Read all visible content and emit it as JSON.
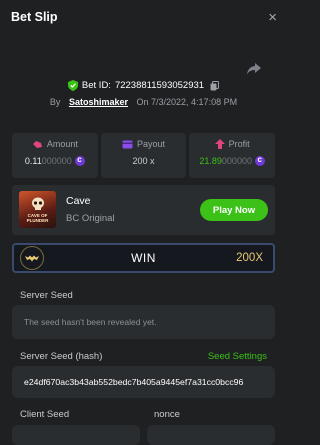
{
  "header": {
    "title": "Bet Slip",
    "close": "×"
  },
  "bet": {
    "id_label": "Bet ID:",
    "id": "72238811593052931",
    "by_label": "By",
    "user": "Satoshimaker",
    "on_label": "On",
    "datetime": "7/3/2022, 4:17:08 PM"
  },
  "stats": {
    "amount": {
      "label": "Amount",
      "value_main": "0.11",
      "value_dim": "000000"
    },
    "payout": {
      "label": "Payout",
      "value": "200 x"
    },
    "profit": {
      "label": "Profit",
      "value_main": "21.89",
      "value_dim": "000000"
    }
  },
  "game": {
    "name": "Cave",
    "provider": "BC Original",
    "play_label": "Play Now",
    "thumb_text": "CAVE OF PLUNDER"
  },
  "result": {
    "label": "WIN",
    "multiplier": "200X"
  },
  "seeds": {
    "server_seed_label": "Server Seed",
    "server_seed_placeholder": "The seed hasn't been revealed yet.",
    "server_hash_label": "Server Seed (hash)",
    "seed_settings_label": "Seed Settings",
    "server_hash": "e24df670ac3b43ab552bedc7b405a9445ef7a31cc0bcc96",
    "client_seed_label": "Client Seed",
    "nonce_label": "nonce"
  },
  "colors": {
    "accent_green": "#3bc117",
    "coin_purple": "#6f3ad6",
    "profit_green": "#3bc117"
  }
}
